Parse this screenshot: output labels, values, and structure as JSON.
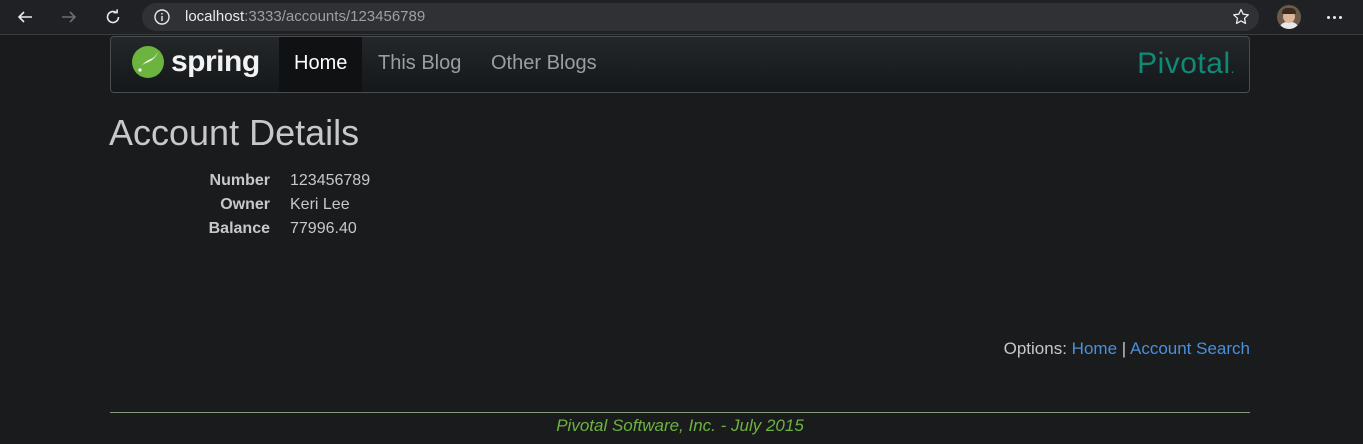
{
  "browser": {
    "url_host": "localhost",
    "url_rest": ":3333/accounts/123456789"
  },
  "navbar": {
    "brand": "spring",
    "items": [
      {
        "label": "Home",
        "active": true
      },
      {
        "label": "This Blog",
        "active": false
      },
      {
        "label": "Other Blogs",
        "active": false
      }
    ],
    "partner_logo": "Pivotal",
    "partner_logo_mark": "."
  },
  "page": {
    "title": "Account Details",
    "details": [
      {
        "label": "Number",
        "value": "123456789"
      },
      {
        "label": "Owner",
        "value": "Keri Lee"
      },
      {
        "label": "Balance",
        "value": "77996.40"
      }
    ]
  },
  "options": {
    "prefix": "Options:",
    "links": [
      {
        "label": "Home"
      },
      {
        "label": "Account Search"
      }
    ],
    "separator": "|"
  },
  "footer": {
    "text": "Pivotal Software, Inc. - July 2015"
  },
  "colors": {
    "spring_green": "#6db33f",
    "pivotal_teal": "#0f8a76",
    "link_blue": "#4a90d9"
  },
  "icons": [
    "back-icon",
    "forward-icon",
    "reload-icon",
    "info-icon",
    "star-icon",
    "more-icon",
    "spring-leaf-icon"
  ]
}
